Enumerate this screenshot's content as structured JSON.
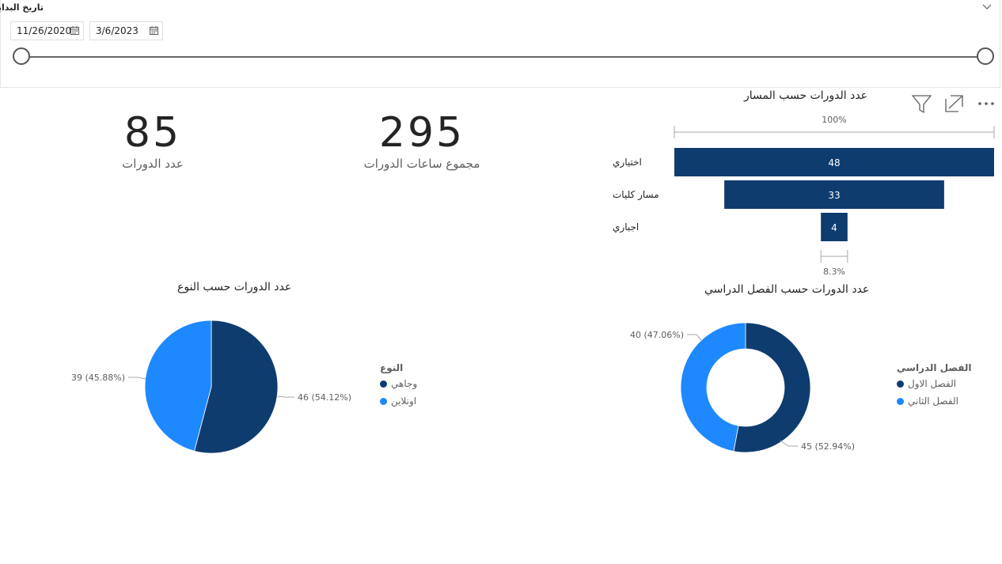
{
  "slicer": {
    "title": "تاريخ البداية",
    "start_date": "11/26/2020",
    "end_date": "3/6/2023",
    "range_fraction": [
      0,
      1
    ]
  },
  "kpis": [
    {
      "value": "85",
      "label": "عدد الدورات"
    },
    {
      "value": "295",
      "label": "مجموع ساعات الدورات"
    }
  ],
  "colors": {
    "dark_blue": "#0f3c6e",
    "light_blue": "#1e88ff"
  },
  "funnel": {
    "title": "عدد الدورات حسب المسار",
    "top_percent": "100%",
    "bottom_percent": "8.3%",
    "icons": [
      "filter-icon",
      "focus-mode-icon",
      "more-options-icon"
    ]
  },
  "pie": {
    "title": "عدد الدورات حسب النوع",
    "legend_title": "النوع",
    "labels": {
      "a": "46 (54.12%)",
      "b": "39 (45.88%)"
    }
  },
  "donut": {
    "title": "عدد الدورات حسب الفصل الدراسي",
    "legend_title": "الفصل الدراسي",
    "labels": {
      "a": "45 (52.94%)",
      "b": "40 (47.06%)"
    }
  },
  "chart_data": [
    {
      "type": "bar",
      "subtype": "funnel",
      "title": "عدد الدورات حسب المسار",
      "categories": [
        "اختياري",
        "مسار كليات",
        "اجباري"
      ],
      "values": [
        48,
        33,
        4
      ]
    },
    {
      "type": "pie",
      "title": "عدد الدورات حسب النوع",
      "legend_title": "النوع",
      "categories": [
        "وجاهي",
        "اونلاين"
      ],
      "values": [
        46,
        39
      ],
      "percentages": [
        54.12,
        45.88
      ],
      "legend": "right"
    },
    {
      "type": "pie",
      "subtype": "donut",
      "title": "عدد الدورات حسب الفصل الدراسي",
      "legend_title": "الفصل الدراسي",
      "categories": [
        "الفصل الاول",
        "الفصل الثاني"
      ],
      "values": [
        45,
        40
      ],
      "percentages": [
        52.94,
        47.06
      ],
      "legend": "right"
    }
  ]
}
